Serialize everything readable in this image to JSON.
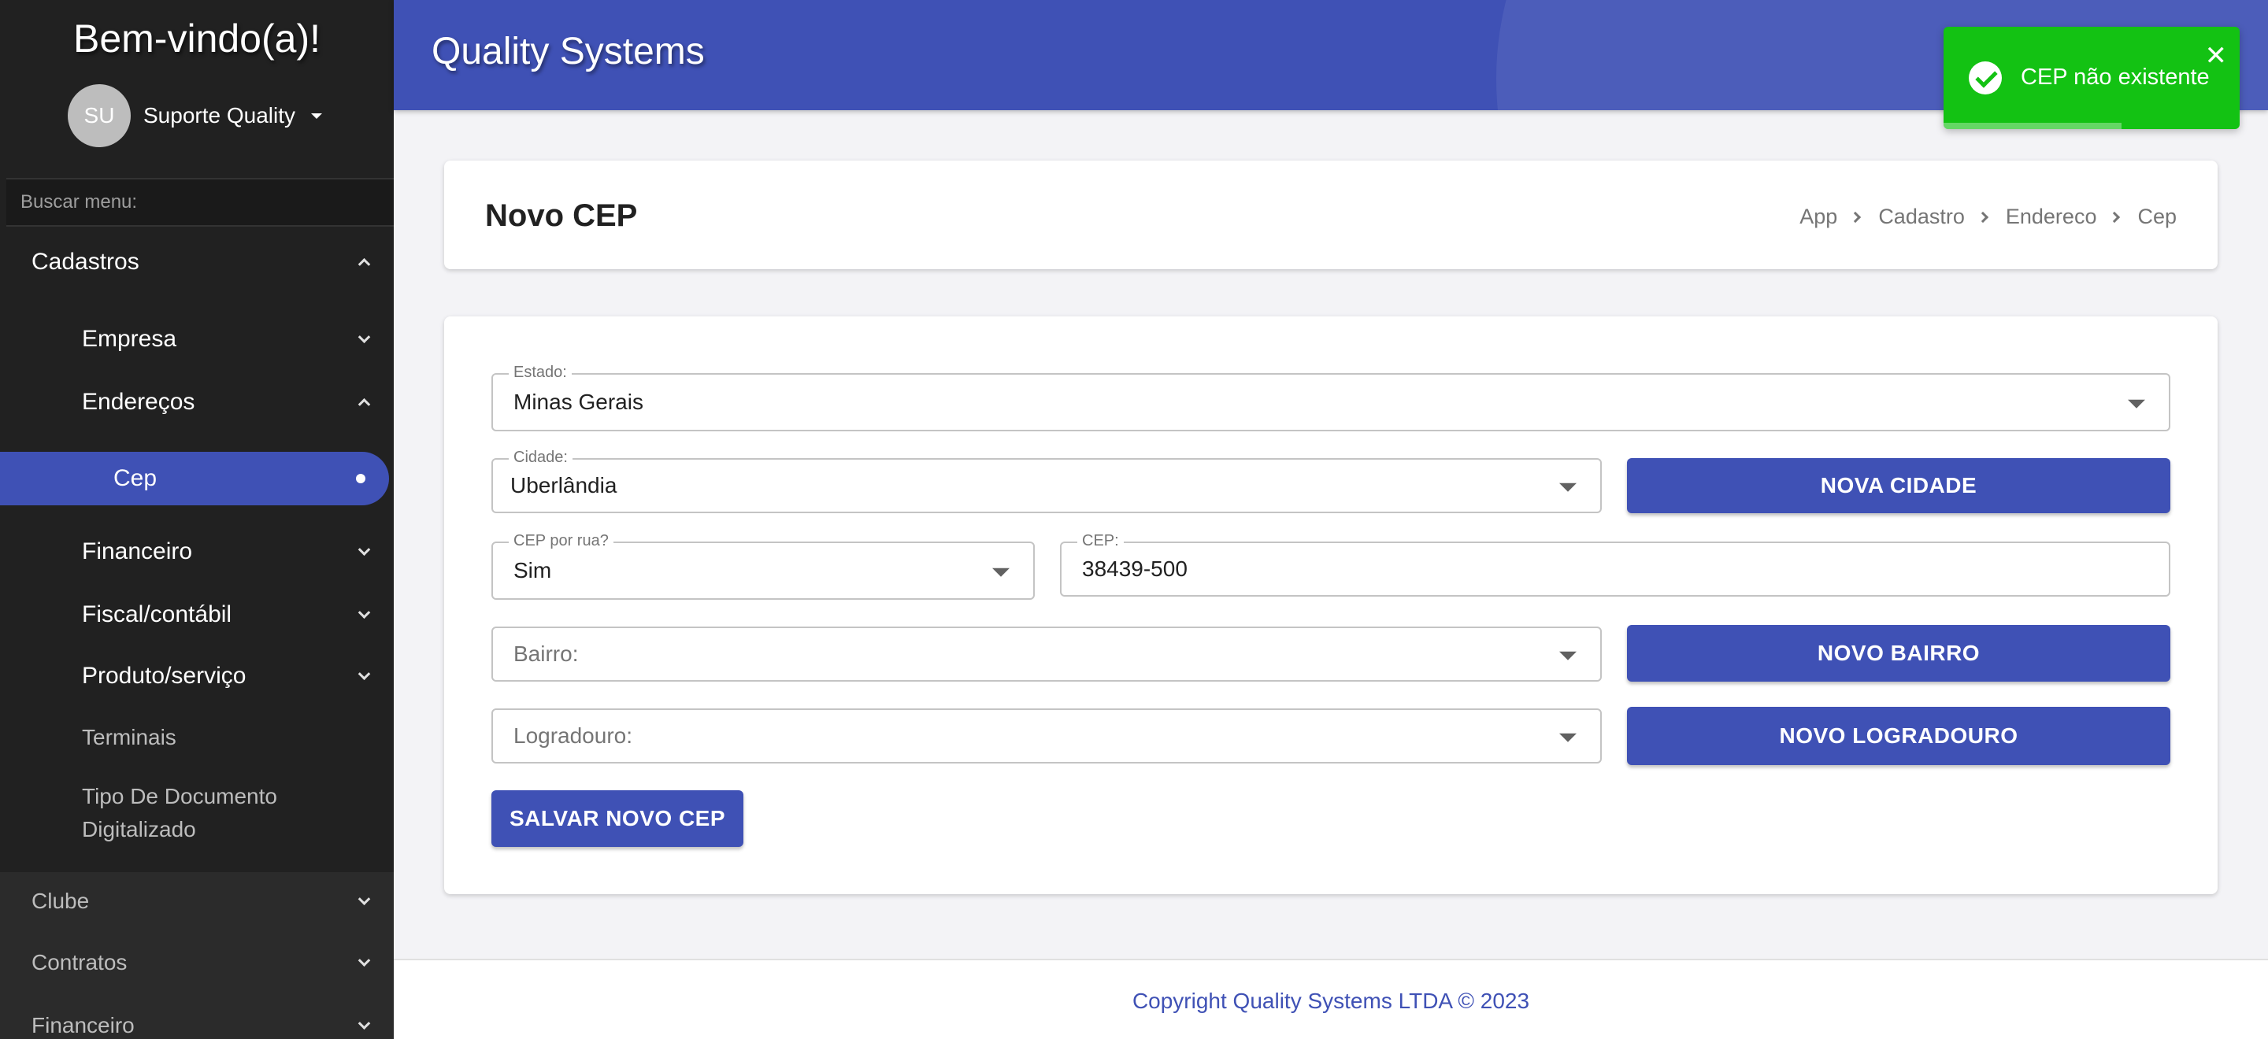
{
  "sidebar": {
    "welcome": "Bem-vindo(a)!",
    "user": {
      "initials": "SU",
      "name": "Suporte Quality"
    },
    "search_placeholder": "Buscar menu:",
    "items": [
      {
        "label": "Cadastros"
      },
      {
        "label": "Empresa"
      },
      {
        "label": "Endereços"
      },
      {
        "label": "Cep"
      },
      {
        "label": "Financeiro"
      },
      {
        "label": "Fiscal/contábil"
      },
      {
        "label": "Produto/serviço"
      },
      {
        "label": "Terminais"
      },
      {
        "label": "Tipo De Documento"
      },
      {
        "label": "Digitalizado"
      },
      {
        "label": "Clube"
      },
      {
        "label": "Contratos"
      },
      {
        "label": "Financeiro"
      }
    ]
  },
  "header": {
    "title": "Quality Systems"
  },
  "toast": {
    "message": "CEP não existente",
    "close": "✕",
    "progress": 0.6
  },
  "page": {
    "title": "Novo CEP",
    "breadcrumb": [
      "App",
      "Cadastro",
      "Endereco",
      "Cep"
    ]
  },
  "form": {
    "estado": {
      "label": "Estado:",
      "value": "Minas Gerais"
    },
    "cidade": {
      "label": "Cidade:",
      "value": "Uberlândia"
    },
    "cep_por_rua": {
      "label": "CEP por rua?",
      "value": "Sim"
    },
    "cep": {
      "label": "CEP:",
      "value": "38439-500"
    },
    "bairro": {
      "placeholder": "Bairro:"
    },
    "logradouro": {
      "placeholder": "Logradouro:"
    },
    "buttons": {
      "nova_cidade": "NOVA CIDADE",
      "novo_bairro": "NOVO BAIRRO",
      "novo_logradouro": "NOVO LOGRADOURO",
      "salvar": "SALVAR NOVO CEP"
    }
  },
  "footer": {
    "copyright": "Copyright Quality Systems LTDA © 2023"
  },
  "colors": {
    "primary": "#3f51b5",
    "sidebar": "#212121",
    "toast": "#13c213"
  }
}
